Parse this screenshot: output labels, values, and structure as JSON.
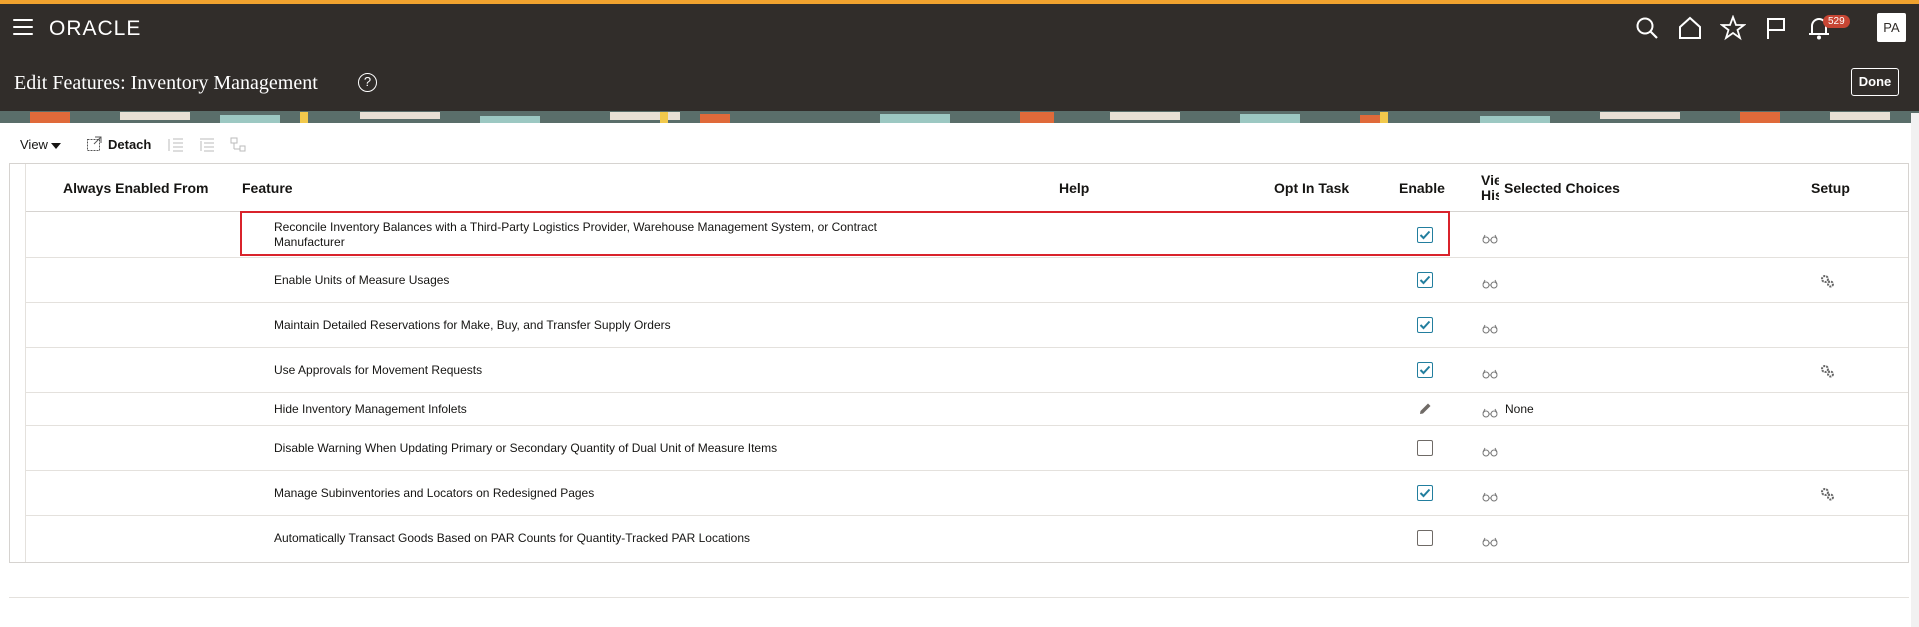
{
  "app": {
    "logo": "ORACLE",
    "user_initials": "PA",
    "notification_count": "529"
  },
  "header": {
    "title": "Edit Features: Inventory Management",
    "help_glyph": "?",
    "done_label": "Done"
  },
  "toolbar": {
    "view_label": "View",
    "detach_label": "Detach"
  },
  "table": {
    "columns": {
      "always_enabled_from": "Always Enabled From",
      "feature": "Feature",
      "help": "Help",
      "opt_in_task": "Opt In Task",
      "enable": "Enable",
      "view_history": "Vie His",
      "selected_choices": "Selected Choices",
      "setup": "Setup"
    },
    "rows": [
      {
        "feature_line1": "Reconcile Inventory Balances with a Third-Party Logistics Provider, Warehouse Management System, or Contract",
        "feature_line2": "Manufacturer",
        "enable": "checked",
        "selected_choices": "",
        "setup": false
      },
      {
        "feature_line1": "Enable Units of Measure Usages",
        "feature_line2": "",
        "enable": "checked",
        "selected_choices": "",
        "setup": true
      },
      {
        "feature_line1": "Maintain Detailed Reservations for Make, Buy, and Transfer Supply Orders",
        "feature_line2": "",
        "enable": "checked",
        "selected_choices": "",
        "setup": false
      },
      {
        "feature_line1": "Use Approvals for Movement Requests",
        "feature_line2": "",
        "enable": "checked",
        "selected_choices": "",
        "setup": true
      },
      {
        "feature_line1": "Hide Inventory Management Infolets",
        "feature_line2": "",
        "enable": "edit",
        "selected_choices": "None",
        "setup": false
      },
      {
        "feature_line1": "Disable Warning When Updating Primary or Secondary Quantity of Dual Unit of Measure Items",
        "feature_line2": "",
        "enable": "unchecked",
        "selected_choices": "",
        "setup": false
      },
      {
        "feature_line1": "Manage Subinventories and Locators on Redesigned Pages",
        "feature_line2": "",
        "enable": "checked",
        "selected_choices": "",
        "setup": true
      },
      {
        "feature_line1": "Automatically Transact Goods Based on PAR Counts for Quantity-Tracked PAR Locations",
        "feature_line2": "",
        "enable": "unchecked",
        "selected_choices": "",
        "setup": false
      }
    ]
  },
  "colors": {
    "header_bg": "#312d2a",
    "accent_bar": "#f0a22e",
    "badge": "#c74634",
    "highlight": "#d9232b",
    "check": "#227e9e"
  },
  "icons": [
    "hamburger-icon",
    "search-icon",
    "home-icon",
    "star-icon",
    "flag-icon",
    "bell-icon",
    "help-icon",
    "view-dropdown-icon",
    "detach-icon",
    "glasses-icon",
    "gear-icon",
    "pencil-icon",
    "checkbox-icon"
  ]
}
